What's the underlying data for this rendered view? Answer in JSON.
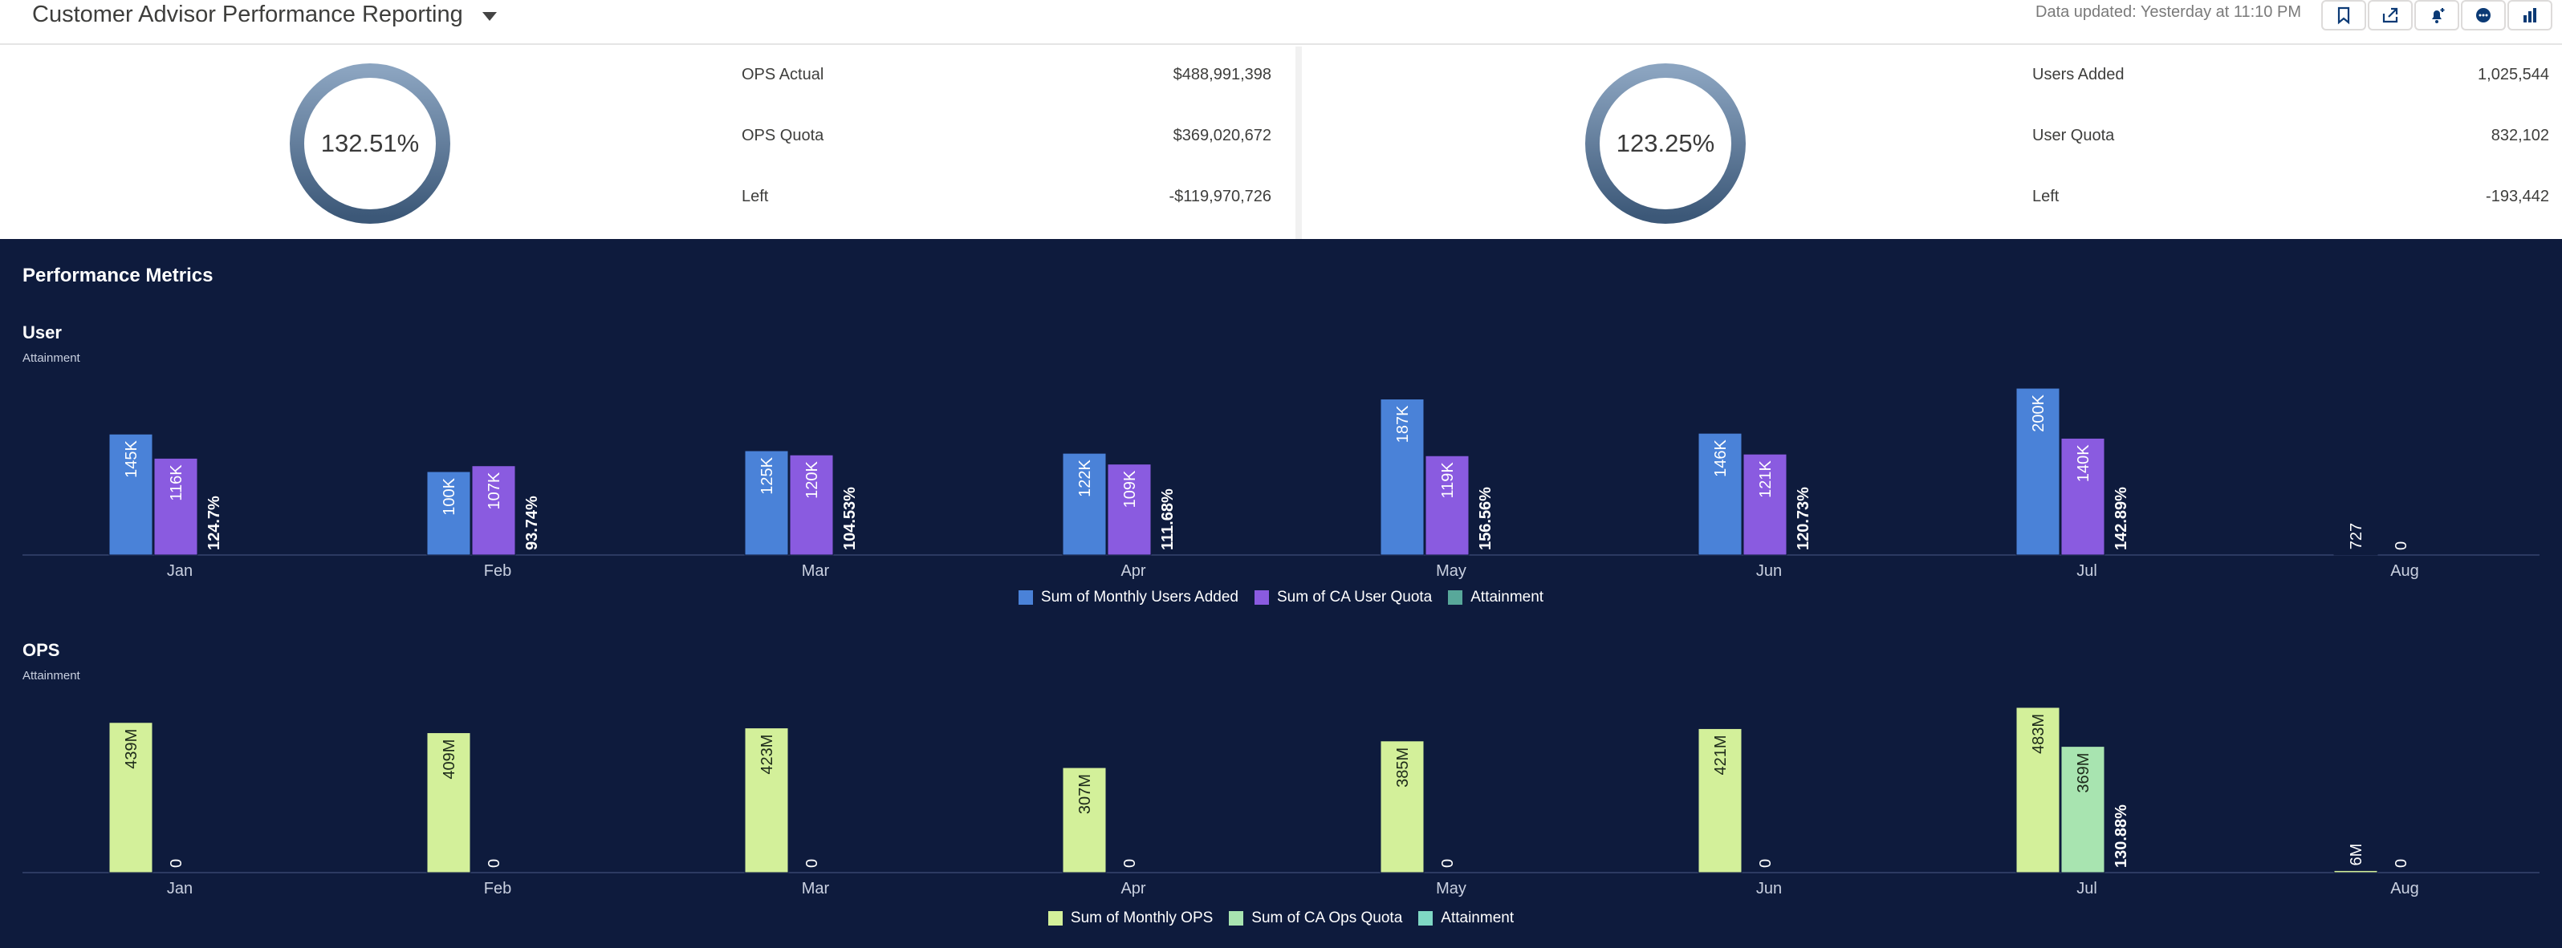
{
  "header": {
    "title": "Customer Advisor Performance Reporting",
    "updated": "Data updated: Yesterday at 11:10 PM",
    "tools": [
      "bookmark-icon",
      "share-icon",
      "notify-icon",
      "chat-icon",
      "chart-icon"
    ]
  },
  "kpi_ops": {
    "percent": "132.51%",
    "ring_fill": 1.0,
    "rows": [
      {
        "label": "OPS Actual",
        "value": "$488,991,398"
      },
      {
        "label": "OPS Quota",
        "value": "$369,020,672"
      },
      {
        "label": "Left",
        "value": "-$119,970,726"
      }
    ]
  },
  "kpi_users": {
    "percent": "123.25%",
    "ring_fill": 1.0,
    "rows": [
      {
        "label": "Users Added",
        "value": "1,025,544"
      },
      {
        "label": "User Quota",
        "value": "832,102"
      },
      {
        "label": "Left",
        "value": "-193,442"
      }
    ]
  },
  "dashboard": {
    "title": "Performance Metrics",
    "user_chart": {
      "title": "User",
      "subtitle": "Attainment"
    },
    "ops_chart": {
      "title": "OPS",
      "subtitle": "Attainment"
    }
  },
  "colors": {
    "users_added": "#4a82d8",
    "user_quota": "#8a5be0",
    "attainment": "#58a89a",
    "ops_actual": "#d3f09a",
    "ops_quota": "#a8e4b0",
    "ops_attainment": "#7fd8c4",
    "dash_bg": "#0e1b3d"
  },
  "chart_data": [
    {
      "type": "bar",
      "title": "User",
      "subtitle": "Attainment",
      "categories": [
        "Jan",
        "Feb",
        "Mar",
        "Apr",
        "May",
        "Jun",
        "Jul",
        "Aug"
      ],
      "series": [
        {
          "name": "Sum of Monthly Users Added",
          "values": [
            145000,
            100000,
            125000,
            122000,
            187000,
            146000,
            200000,
            727
          ],
          "labels": [
            "145K",
            "100K",
            "125K",
            "122K",
            "187K",
            "146K",
            "200K",
            "727"
          ]
        },
        {
          "name": "Sum of CA User Quota",
          "values": [
            116000,
            107000,
            120000,
            109000,
            119000,
            121000,
            140000,
            0
          ],
          "labels": [
            "116K",
            "107K",
            "120K",
            "109K",
            "119K",
            "121K",
            "140K",
            "0"
          ]
        },
        {
          "name": "Attainment",
          "values": [
            124.7,
            93.74,
            104.53,
            111.68,
            156.56,
            120.73,
            142.89,
            null
          ],
          "labels": [
            "124.7%",
            "93.74%",
            "104.53%",
            "111.68%",
            "156.56%",
            "120.73%",
            "142.89%",
            ""
          ]
        }
      ],
      "legend": [
        "Sum of Monthly Users Added",
        "Sum of CA User Quota",
        "Attainment"
      ],
      "ylim": [
        0,
        200000
      ]
    },
    {
      "type": "bar",
      "title": "OPS",
      "subtitle": "Attainment",
      "categories": [
        "Jan",
        "Feb",
        "Mar",
        "Apr",
        "May",
        "Jun",
        "Jul",
        "Aug"
      ],
      "series": [
        {
          "name": "Sum of Monthly OPS",
          "values": [
            439000000,
            409000000,
            423000000,
            307000000,
            385000000,
            421000000,
            483000000,
            6000000
          ],
          "labels": [
            "439M",
            "409M",
            "423M",
            "307M",
            "385M",
            "421M",
            "483M",
            "6M"
          ]
        },
        {
          "name": "Sum of CA Ops Quota",
          "values": [
            0,
            0,
            0,
            0,
            0,
            0,
            369000000,
            0
          ],
          "labels": [
            "0",
            "0",
            "0",
            "0",
            "0",
            "0",
            "369M",
            "0"
          ]
        },
        {
          "name": "Attainment",
          "values": [
            null,
            null,
            null,
            null,
            null,
            null,
            130.88,
            null
          ],
          "labels": [
            "",
            "",
            "",
            "",
            "",
            "",
            "130.88%",
            ""
          ]
        }
      ],
      "legend": [
        "Sum of Monthly OPS",
        "Sum of CA Ops Quota",
        "Attainment"
      ],
      "ylim": [
        0,
        483000000
      ]
    }
  ]
}
